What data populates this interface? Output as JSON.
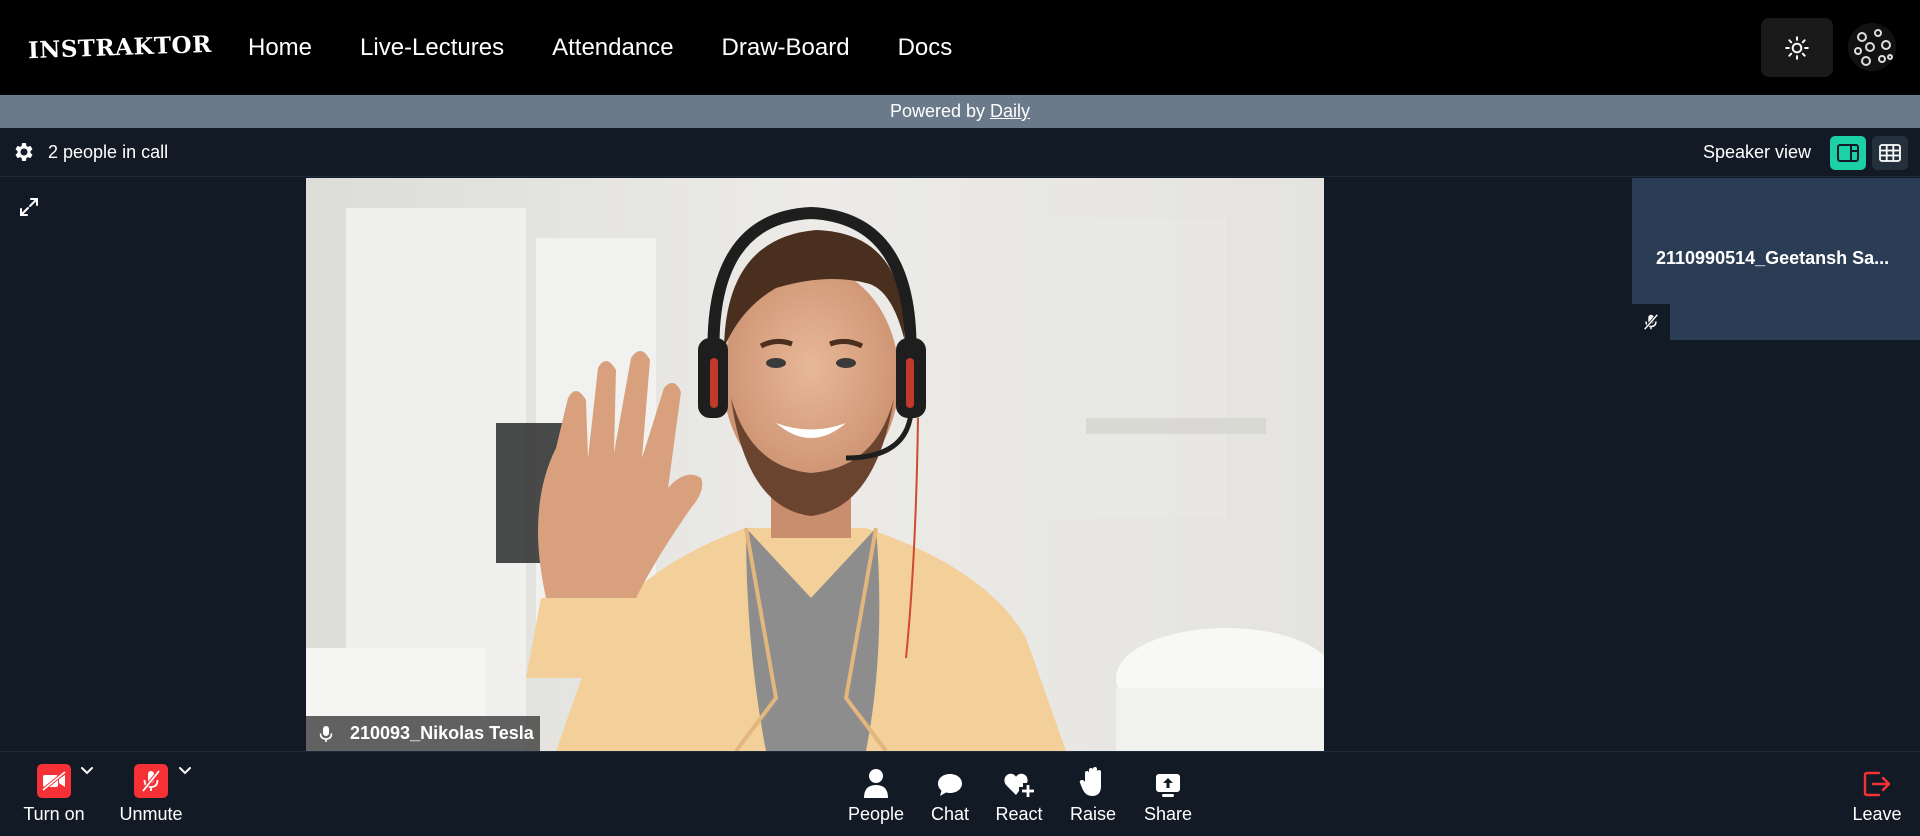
{
  "app": {
    "logo_text": "INSTRAKTOR"
  },
  "nav": {
    "links": [
      "Home",
      "Live-Lectures",
      "Attendance",
      "Draw-Board",
      "Docs"
    ]
  },
  "banner": {
    "prefix": "Powered by",
    "link": "Daily"
  },
  "call": {
    "people_count": "2 people in call",
    "view_label": "Speaker view"
  },
  "speaker": {
    "name": "210093_Nikolas Tesla"
  },
  "tile": {
    "name": "2110990514_Geetansh Sa..."
  },
  "tray": {
    "camera_label": "Turn on",
    "mic_label": "Unmute",
    "people_label": "People",
    "chat_label": "Chat",
    "react_label": "React",
    "raise_label": "Raise",
    "share_label": "Share",
    "leave_label": "Leave"
  },
  "colors": {
    "accent": "#1bd1a5",
    "danger": "#f63135",
    "background": "#121a25",
    "tile": "#2b3d55",
    "banner": "#6b7a8a"
  },
  "icons": [
    "sun-icon",
    "settings-icon",
    "speaker-view-icon",
    "grid-view-icon",
    "expand-icon",
    "mic-icon",
    "mic-off-icon",
    "camera-off-icon",
    "chevron-down-icon",
    "person-icon",
    "chat-icon",
    "heart-plus-icon",
    "hand-icon",
    "share-screen-icon",
    "leave-icon"
  ]
}
